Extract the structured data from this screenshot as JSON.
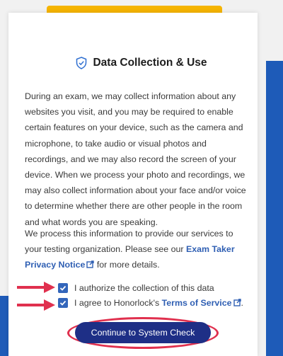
{
  "dialog": {
    "title": "Data Collection & Use",
    "paragraph1": "During an exam, we may collect information about any websites you visit, and you may be required to enable certain features on your device, such as the camera and microphone, to take audio or visual photos and recordings, and we may also record the screen of your device. When we process your photo and recordings, we may also collect information about your face and/or voice to determine whether there are other people in the room and what words you are speaking.",
    "paragraph2_before": "We process this information to provide our services to your testing organization. Please see our ",
    "privacy_link": "Exam Taker Privacy Notice",
    "paragraph2_after": " for more details.",
    "checkbox1_label": "I authorize the collection of this data",
    "checkbox2_before": "I agree to Honorlock's ",
    "terms_link": "Terms of Service",
    "checkbox2_after": ".",
    "continue_button": "Continue to System Check"
  },
  "colors": {
    "accent_blue": "#1e5bb8",
    "link_blue": "#2f5fb3",
    "button_navy": "#1e2f86",
    "annotation_red": "#e0304e",
    "yellow": "#f5b400"
  }
}
